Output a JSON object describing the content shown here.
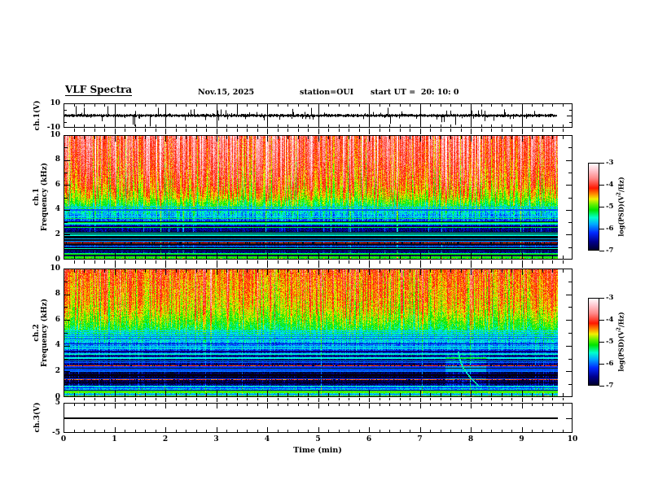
{
  "header": {
    "title": "VLF Spectra",
    "date": "Nov.15, 2025",
    "station": "station=OUI",
    "start_ut": "start UT =  20: 10: 0"
  },
  "x_axis": {
    "label": "Time (min)",
    "min": 0,
    "max": 10,
    "tick_values": [
      0,
      1,
      2,
      3,
      4,
      5,
      6,
      7,
      8,
      9,
      10
    ],
    "tick_labels": [
      "0",
      "1",
      "2",
      "3",
      "4",
      "5",
      "6",
      "7",
      "8",
      "9",
      "10"
    ],
    "minor_step_min": 0.2,
    "data_end_min": 9.7
  },
  "panels": [
    {
      "id": "ch1_voltage",
      "ylabel": "ch.1(V)",
      "ymin": -10,
      "ymax": 10,
      "yticks": [
        {
          "v": 10,
          "label": "10"
        },
        {
          "v": -10,
          "label": "-10"
        }
      ]
    },
    {
      "id": "ch1_spec",
      "ylabel_lines": [
        "ch.1",
        "Frequency (kHz)"
      ],
      "ymin": 0,
      "ymax": 10,
      "yticks": [
        {
          "v": 10,
          "label": "10"
        },
        {
          "v": 8,
          "label": "8"
        },
        {
          "v": 6,
          "label": "6"
        },
        {
          "v": 4,
          "label": "4"
        },
        {
          "v": 2,
          "label": "2"
        },
        {
          "v": 0,
          "label": "0"
        }
      ]
    },
    {
      "id": "ch2_spec",
      "ylabel_lines": [
        "ch.2",
        "Frequency (kHz)"
      ],
      "ymin": 0,
      "ymax": 10,
      "yticks": [
        {
          "v": 10,
          "label": "10"
        },
        {
          "v": 8,
          "label": "8"
        },
        {
          "v": 6,
          "label": "6"
        },
        {
          "v": 4,
          "label": "4"
        },
        {
          "v": 2,
          "label": "2"
        },
        {
          "v": 0,
          "label": "0"
        }
      ]
    },
    {
      "id": "ch3_voltage",
      "ylabel": "ch.3(V)",
      "ymin": -5,
      "ymax": 5,
      "yticks": [
        {
          "v": 5,
          "label": "5"
        },
        {
          "v": -5,
          "label": "-5"
        }
      ]
    }
  ],
  "colorbar": {
    "label_pre": "log(PSD)(V",
    "label_sup": "2",
    "label_post": "/Hz)",
    "ticks": [
      "-3",
      "-4",
      "-5",
      "-6",
      "-7"
    ],
    "vmax": -3,
    "vmin": -7
  },
  "colors": {
    "axis": "#000000",
    "background": "#ffffff"
  },
  "colormap": [
    [
      -7.3,
      "#000010"
    ],
    [
      -7.0,
      "#000028"
    ],
    [
      -6.6,
      "#000090"
    ],
    [
      -6.2,
      "#0028ff"
    ],
    [
      -5.8,
      "#00aaff"
    ],
    [
      -5.5,
      "#00ffcc"
    ],
    [
      -5.15,
      "#00e400"
    ],
    [
      -4.9,
      "#66f000"
    ],
    [
      -4.65,
      "#f0f000"
    ],
    [
      -4.45,
      "#ff9800"
    ],
    [
      -4.15,
      "#ff1800"
    ],
    [
      -3.7,
      "#ff8888"
    ],
    [
      -3.3,
      "#ffccd4"
    ],
    [
      -3.0,
      "#ffffff"
    ]
  ],
  "chart_data": [
    {
      "id": "ch1_waveform",
      "type": "line",
      "channel": "ch.1(V)",
      "xlim": [
        0,
        10
      ],
      "ylim": [
        -10,
        10
      ],
      "x_end_min": 9.7,
      "baseline": 0,
      "noise_band_volts": 1.4,
      "spike_count": 60,
      "spike_amp_min": 2.5,
      "spike_amp_max": 9.5,
      "minute_gridlines": [
        1,
        2,
        3,
        4,
        5,
        6,
        7,
        8,
        9
      ],
      "seed": 11
    },
    {
      "id": "ch1_spectrogram",
      "type": "heatmap",
      "channel": "ch.1",
      "ylabel": "Frequency (kHz)",
      "xlim": [
        0,
        10
      ],
      "ylim": [
        0,
        10
      ],
      "x_end_min": 9.7,
      "value_range": [
        -7,
        -3
      ],
      "base_profile": [
        [
          10,
          -4.35
        ],
        [
          9.7,
          -4.5
        ],
        [
          9,
          -4.55
        ],
        [
          8,
          -4.65
        ],
        [
          7,
          -4.8
        ],
        [
          6,
          -5.0
        ],
        [
          5,
          -5.25
        ],
        [
          4.5,
          -5.55
        ],
        [
          4,
          -5.85
        ],
        [
          3.5,
          -6.1
        ],
        [
          3,
          -6.4
        ],
        [
          2.6,
          -6.65
        ],
        [
          2,
          -6.9
        ],
        [
          1.3,
          -6.9
        ],
        [
          1,
          -6.75
        ],
        [
          0.7,
          -6.6
        ],
        [
          0.4,
          -6.45
        ],
        [
          0.2,
          -6.1
        ],
        [
          0.1,
          -5.2
        ],
        [
          0,
          -5.0
        ]
      ],
      "streaks": {
        "density": 0.92,
        "strong_fraction": 0.3,
        "boost_top": 1.15,
        "fade_below_khz": 6,
        "full_height_fraction": 0.09,
        "seed": 21
      },
      "hlines": {
        "below_khz": 4.4,
        "bright_fraction": 0.3,
        "dark_fraction": 0.3,
        "bright_amp": 1.45,
        "dark_amp": 0.75,
        "seed": 31
      },
      "features": [
        {
          "type": "hline",
          "f_khz": 1.35,
          "level": -4.2,
          "half_width_khz": 0.035
        }
      ]
    },
    {
      "id": "ch2_spectrogram",
      "type": "heatmap",
      "channel": "ch.2",
      "ylabel": "Frequency (kHz)",
      "xlim": [
        0,
        10
      ],
      "ylim": [
        0,
        10
      ],
      "x_end_min": 9.7,
      "value_range": [
        -7,
        -3
      ],
      "base_profile": [
        [
          10,
          -4.55
        ],
        [
          9.75,
          -4.7
        ],
        [
          9,
          -4.8
        ],
        [
          8,
          -4.9
        ],
        [
          7,
          -5.05
        ],
        [
          6,
          -5.3
        ],
        [
          5,
          -5.7
        ],
        [
          4.5,
          -5.95
        ],
        [
          4,
          -6.15
        ],
        [
          3.5,
          -6.35
        ],
        [
          3,
          -6.55
        ],
        [
          2.4,
          -6.9
        ],
        [
          1.6,
          -7.0
        ],
        [
          1.1,
          -6.95
        ],
        [
          0.9,
          -6.6
        ],
        [
          0.8,
          -5.9
        ],
        [
          0.3,
          -5.65
        ],
        [
          0.15,
          -5.2
        ],
        [
          0,
          -5.0
        ]
      ],
      "streaks": {
        "density": 0.9,
        "strong_fraction": 0.08,
        "boost_top": 0.95,
        "fade_below_khz": 7,
        "full_height_fraction": 0.1,
        "seed": 22
      },
      "hlines": {
        "below_khz": 5.2,
        "bright_fraction": 0.28,
        "dark_fraction": 0.3,
        "bright_amp": 1.3,
        "dark_amp": 0.7,
        "seed": 32
      },
      "features": [
        {
          "type": "hline",
          "f_khz": 2.45,
          "level": -4.25,
          "half_width_khz": 0.03
        },
        {
          "type": "hline",
          "f_khz": 1.4,
          "level": -4.3,
          "half_width_khz": 0.03
        },
        {
          "type": "patch",
          "t0": 7.5,
          "t1": 8.3,
          "f0": 0.9,
          "f1": 3.3,
          "delta": 0.3
        },
        {
          "type": "whistler",
          "t0_min": 7.75,
          "f_top_khz": 3.6,
          "f_bottom_khz": 0.9,
          "dt_min": 0.4,
          "level": -5.5
        }
      ]
    },
    {
      "id": "ch3_line",
      "type": "line",
      "channel": "ch.3(V)",
      "xlim": [
        0,
        10
      ],
      "ylim": [
        -5,
        5
      ],
      "x_end_min": 9.7,
      "value": 0
    }
  ]
}
